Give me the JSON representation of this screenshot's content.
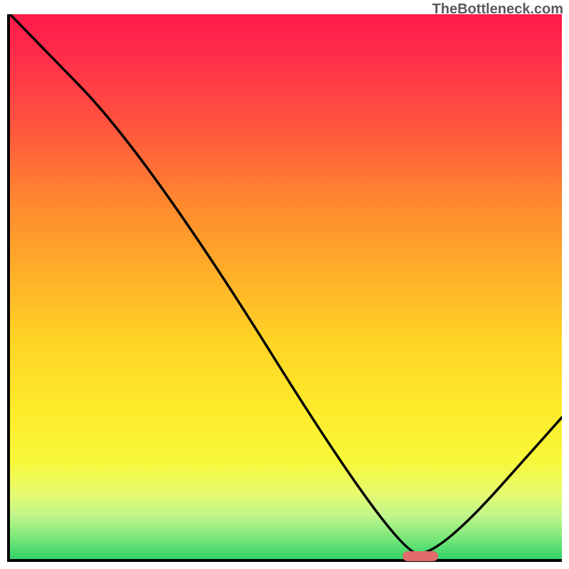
{
  "attribution": "TheBottleneck.com",
  "chart_data": {
    "type": "line",
    "title": "",
    "xlabel": "",
    "ylabel": "",
    "xlim": [
      0,
      100
    ],
    "ylim": [
      0,
      100
    ],
    "x": [
      0,
      25,
      70,
      78,
      100
    ],
    "values": [
      100,
      74,
      1,
      1,
      26
    ],
    "gradient_bands": [
      {
        "pos": 0,
        "color": "#ff1a4a"
      },
      {
        "pos": 50,
        "color": "#ffc427"
      },
      {
        "pos": 85,
        "color": "#f4f94e"
      },
      {
        "pos": 100,
        "color": "#2fd36a"
      }
    ],
    "marker": {
      "x": 74,
      "y": 1,
      "color": "#e26a6a"
    }
  }
}
